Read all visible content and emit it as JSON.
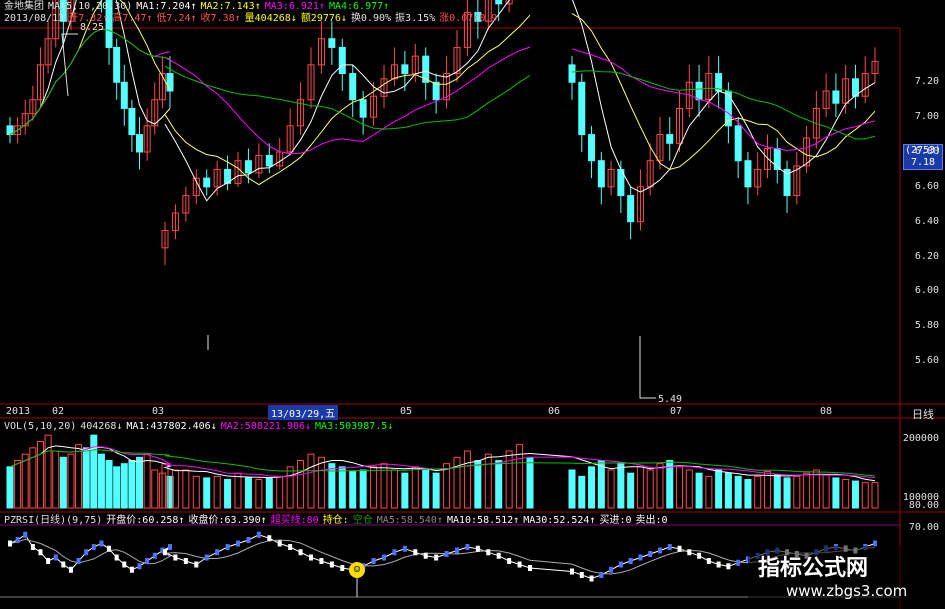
{
  "price_header": {
    "line1": [
      {
        "text": "金地集团",
        "color": "#e0e0e0"
      },
      {
        "text": "MA(5,10,20,30)",
        "color": "#e0e0e0"
      },
      {
        "text": "MA1:7.204↑",
        "color": "#ffffff"
      },
      {
        "text": "MA2:7.143↑",
        "color": "#ffff00"
      },
      {
        "text": "MA3:6.921↑",
        "color": "#ff00ff"
      },
      {
        "text": "MA4:6.977↑",
        "color": "#00ff00"
      }
    ],
    "line2": [
      {
        "text": "2013/08/13",
        "color": "#e0e0e0"
      },
      {
        "text": "开7.32↑",
        "color": "#ff5050"
      },
      {
        "text": "高7.47↑",
        "color": "#ff5050"
      },
      {
        "text": "低7.24↑",
        "color": "#ff5050"
      },
      {
        "text": "收7.38↑",
        "color": "#ff5050"
      },
      {
        "text": "量404268↓",
        "color": "#ffff00"
      },
      {
        "text": "额29776↓",
        "color": "#ffff00"
      },
      {
        "text": "换0.90%",
        "color": "#e0e0e0"
      },
      {
        "text": "振3.15%",
        "color": "#e0e0e0"
      },
      {
        "text": "涨0.07(0.9",
        "color": "#ff5050"
      }
    ]
  },
  "price_axis": [
    "7.20",
    "7.00",
    "6.80",
    "6.60",
    "6.40",
    "6.20",
    "6.00",
    "5.80",
    "5.60"
  ],
  "price_badge": {
    "top": "(2753)",
    "value": "7.18"
  },
  "high_mark": "8.25",
  "low_mark": "5.49",
  "x_axis": {
    "labels": [
      "2013",
      "02",
      "03",
      "05",
      "06",
      "07",
      "08"
    ],
    "cursor_label": "13/03/29,五",
    "period": "日线"
  },
  "vol_header": [
    {
      "text": "VOL(5,10,20)",
      "color": "#e0e0e0"
    },
    {
      "text": "404268↓",
      "color": "#e0e0e0"
    },
    {
      "text": "MA1:437802.406↓",
      "color": "#ffffff"
    },
    {
      "text": "MA2:508221.906↓",
      "color": "#ff00ff"
    },
    {
      "text": "MA3:503987.5↓",
      "color": "#00ff00"
    }
  ],
  "vol_axis": [
    "200000",
    "100000"
  ],
  "ind_header": [
    {
      "text": "PZRSI(日线)(9,75)",
      "color": "#e0e0e0"
    },
    {
      "text": "开盘价:60.258↑",
      "color": "#ffffff"
    },
    {
      "text": "收盘价:63.390↑",
      "color": "#ffffff"
    },
    {
      "text": "超买线:80",
      "color": "#ff00ff"
    },
    {
      "text": "持仓:",
      "color": "#ffff00"
    },
    {
      "text": "空仓",
      "color": "#00a000"
    },
    {
      "text": "MA5:58.540↑",
      "color": "#888888"
    },
    {
      "text": "MA10:58.512↑",
      "color": "#ffffff"
    },
    {
      "text": "MA30:52.524↑",
      "color": "#ffffff"
    },
    {
      "text": "买进:0",
      "color": "#ffffff"
    },
    {
      "text": "卖出:0",
      "color": "#ffffff"
    }
  ],
  "ind_axis": [
    "80.00",
    "70.00"
  ],
  "watermark": {
    "line1": "指标公式网",
    "line2": "www.zbgs3.com"
  },
  "smile_icon": "☺",
  "colors": {
    "up": "#ff4a4a",
    "down": "#54ffff",
    "bg": "#000000",
    "grid": "#a00000"
  },
  "candles": [
    [
      6.95,
      6.9,
      7.0,
      6.85
    ],
    [
      6.9,
      6.95,
      7.0,
      6.85
    ],
    [
      6.95,
      7.02,
      7.1,
      6.9
    ],
    [
      7.02,
      7.1,
      7.18,
      6.98
    ],
    [
      7.1,
      7.3,
      7.4,
      7.05
    ],
    [
      7.3,
      7.45,
      7.55,
      7.25
    ],
    [
      7.45,
      7.7,
      7.8,
      7.4
    ],
    [
      7.7,
      7.55,
      7.8,
      7.4
    ],
    [
      7.55,
      7.8,
      7.95,
      7.5
    ],
    [
      7.8,
      8.1,
      8.25,
      7.75
    ],
    [
      8.1,
      8.0,
      8.2,
      7.9
    ],
    [
      8.0,
      7.95,
      8.1,
      7.85
    ],
    [
      7.95,
      7.75,
      8.05,
      7.6
    ],
    [
      7.75,
      7.4,
      7.8,
      7.3
    ],
    [
      7.4,
      7.2,
      7.45,
      7.1
    ],
    [
      7.2,
      7.05,
      7.3,
      6.95
    ],
    [
      7.05,
      6.9,
      7.1,
      6.8
    ],
    [
      6.9,
      6.8,
      7.0,
      6.7
    ],
    [
      6.8,
      6.95,
      7.05,
      6.75
    ],
    [
      6.95,
      7.1,
      7.2,
      6.9
    ],
    [
      7.1,
      7.25,
      7.35,
      7.05
    ],
    [
      7.25,
      7.15,
      7.35,
      7.05
    ],
    [
      6.25,
      6.35,
      6.4,
      6.15
    ],
    [
      6.35,
      6.45,
      6.5,
      6.3
    ],
    [
      6.45,
      6.55,
      6.6,
      6.4
    ],
    [
      6.55,
      6.65,
      6.7,
      6.5
    ],
    [
      6.65,
      6.6,
      6.7,
      6.55
    ],
    [
      6.6,
      6.7,
      6.75,
      6.55
    ],
    [
      6.7,
      6.62,
      6.78,
      6.58
    ],
    [
      6.62,
      6.75,
      6.8,
      6.6
    ],
    [
      6.75,
      6.68,
      6.82,
      6.62
    ],
    [
      6.68,
      6.78,
      6.85,
      6.65
    ],
    [
      6.78,
      6.72,
      6.85,
      6.68
    ],
    [
      6.72,
      6.8,
      6.88,
      6.7
    ],
    [
      6.8,
      6.95,
      7.05,
      6.78
    ],
    [
      6.95,
      7.1,
      7.2,
      6.9
    ],
    [
      7.1,
      7.3,
      7.4,
      7.05
    ],
    [
      7.3,
      7.45,
      7.55,
      7.25
    ],
    [
      7.45,
      7.4,
      7.55,
      7.3
    ],
    [
      7.4,
      7.25,
      7.45,
      7.15
    ],
    [
      7.25,
      7.1,
      7.3,
      7.0
    ],
    [
      7.1,
      7.0,
      7.15,
      6.9
    ],
    [
      7.0,
      7.12,
      7.2,
      6.95
    ],
    [
      7.12,
      7.22,
      7.3,
      7.05
    ],
    [
      7.22,
      7.3,
      7.4,
      7.18
    ],
    [
      7.3,
      7.25,
      7.38,
      7.15
    ],
    [
      7.25,
      7.35,
      7.42,
      7.2
    ],
    [
      7.35,
      7.2,
      7.4,
      7.1
    ],
    [
      7.2,
      7.1,
      7.25,
      7.02
    ],
    [
      7.1,
      7.25,
      7.35,
      7.05
    ],
    [
      7.25,
      7.4,
      7.5,
      7.2
    ],
    [
      7.4,
      7.6,
      7.7,
      7.35
    ],
    [
      7.6,
      7.55,
      7.75,
      7.45
    ],
    [
      7.55,
      7.75,
      7.9,
      7.5
    ],
    [
      7.75,
      7.65,
      7.85,
      7.55
    ],
    [
      7.65,
      7.8,
      7.95,
      7.6
    ],
    [
      7.8,
      7.9,
      8.05,
      7.75
    ],
    [
      7.9,
      7.85,
      8.2,
      7.78
    ],
    [
      7.3,
      7.2,
      7.35,
      7.1
    ],
    [
      7.2,
      6.9,
      7.25,
      6.8
    ],
    [
      6.9,
      6.75,
      6.95,
      6.65
    ],
    [
      6.75,
      6.6,
      6.8,
      6.5
    ],
    [
      6.6,
      6.7,
      6.75,
      6.55
    ],
    [
      6.7,
      6.55,
      6.75,
      6.45
    ],
    [
      6.55,
      6.4,
      6.6,
      6.3
    ],
    [
      6.4,
      6.6,
      6.7,
      6.35
    ],
    [
      6.6,
      6.75,
      6.85,
      6.55
    ],
    [
      6.75,
      6.9,
      7.0,
      6.7
    ],
    [
      6.9,
      6.85,
      7.0,
      6.75
    ],
    [
      6.85,
      7.05,
      7.15,
      6.8
    ],
    [
      7.05,
      7.2,
      7.3,
      7.0
    ],
    [
      7.2,
      7.1,
      7.3,
      7.0
    ],
    [
      7.1,
      7.25,
      7.35,
      7.05
    ],
    [
      7.25,
      7.15,
      7.35,
      7.05
    ],
    [
      7.15,
      6.95,
      7.2,
      6.85
    ],
    [
      6.95,
      6.75,
      7.0,
      6.65
    ],
    [
      6.75,
      6.6,
      6.8,
      6.5
    ],
    [
      6.6,
      6.7,
      6.8,
      6.55
    ],
    [
      6.7,
      6.82,
      6.9,
      6.65
    ],
    [
      6.82,
      6.7,
      6.88,
      6.62
    ],
    [
      6.7,
      6.55,
      6.75,
      6.45
    ],
    [
      6.55,
      6.72,
      6.8,
      6.5
    ],
    [
      6.72,
      6.88,
      6.95,
      6.68
    ],
    [
      6.88,
      7.05,
      7.15,
      6.82
    ],
    [
      7.05,
      7.15,
      7.25,
      7.0
    ],
    [
      7.15,
      7.08,
      7.25,
      7.0
    ],
    [
      7.08,
      7.22,
      7.3,
      7.02
    ],
    [
      7.22,
      7.12,
      7.3,
      7.05
    ],
    [
      7.12,
      7.25,
      7.35,
      7.08
    ],
    [
      7.25,
      7.32,
      7.4,
      7.2
    ]
  ],
  "volumes": [
    130,
    150,
    170,
    190,
    210,
    230,
    180,
    160,
    170,
    200,
    190,
    230,
    170,
    150,
    130,
    140,
    150,
    160,
    170,
    120,
    110,
    100,
    140,
    120,
    120,
    100,
    95,
    100,
    90,
    110,
    95,
    90,
    95,
    100,
    130,
    150,
    170,
    160,
    140,
    130,
    115,
    120,
    130,
    140,
    120,
    110,
    130,
    120,
    110,
    140,
    160,
    180,
    150,
    170,
    150,
    180,
    200,
    160,
    120,
    100,
    130,
    150,
    120,
    140,
    110,
    130,
    120,
    140,
    150,
    130,
    120,
    110,
    100,
    120,
    110,
    100,
    90,
    100,
    115,
    105,
    95,
    100,
    110,
    120,
    105,
    95,
    90,
    85,
    80,
    80
  ],
  "rsi": [
    60,
    62,
    65,
    58,
    55,
    50,
    52,
    48,
    45,
    50,
    55,
    58,
    60,
    57,
    52,
    48,
    45,
    47,
    50,
    53,
    56,
    58,
    55,
    52,
    50,
    48,
    52,
    55,
    58,
    60,
    62,
    65,
    63,
    60,
    58,
    55,
    52,
    50,
    48,
    46,
    45,
    47,
    50,
    52,
    55,
    57,
    55,
    53,
    52,
    54,
    56,
    58,
    57,
    55,
    53,
    50,
    48,
    46,
    44,
    42,
    40,
    42,
    45,
    48,
    50,
    52,
    54,
    56,
    58,
    57,
    55,
    53,
    50,
    48,
    47,
    49,
    51,
    53,
    55,
    56,
    55,
    54,
    53,
    55,
    57,
    58,
    57,
    56,
    58,
    60
  ]
}
